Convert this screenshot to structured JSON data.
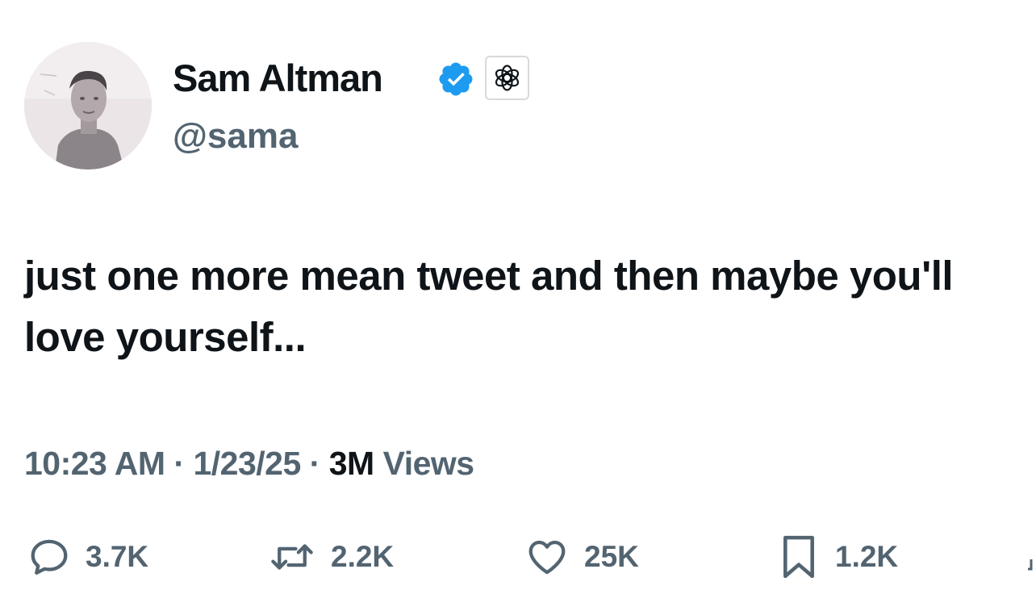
{
  "author": {
    "display_name": "Sam Altman",
    "handle": "@sama",
    "verified": true,
    "verified_badge_color": "#1d9bf0",
    "icons": {
      "verified": "verified-badge-icon",
      "affiliation": "openai-logo-icon"
    }
  },
  "tweet": {
    "text": "just one more mean tweet and then maybe you'll love yourself..."
  },
  "meta": {
    "time": "10:23 AM",
    "separator": "·",
    "date": "1/23/25",
    "views_count": "3M",
    "views_label": "Views"
  },
  "actions": {
    "reply": {
      "icon": "reply-icon",
      "count": "3.7K"
    },
    "repost": {
      "icon": "repost-icon",
      "count": "2.2K"
    },
    "like": {
      "icon": "heart-icon",
      "count": "25K"
    },
    "bookmark": {
      "icon": "bookmark-icon",
      "count": "1.2K"
    },
    "share": {
      "icon": "share-icon"
    }
  },
  "colors": {
    "text_primary": "#0f1419",
    "text_secondary": "#536471",
    "background": "#ffffff"
  }
}
